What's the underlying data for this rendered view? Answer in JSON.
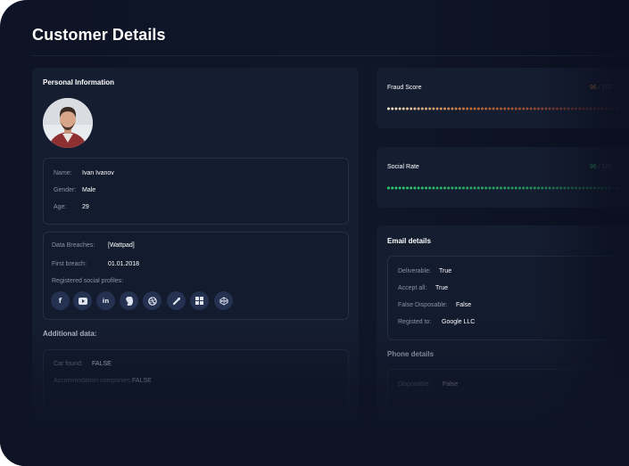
{
  "page_title": "Customer Details",
  "personal": {
    "heading": "Personal Information",
    "name_label": "Name:",
    "name": "Ivan Ivanov",
    "gender_label": "Gender:",
    "gender": "Male",
    "age_label": "Age:",
    "age": "29"
  },
  "breaches": {
    "data_breaches_label": "Data Breaches:",
    "data_breaches": "[Wattpad]",
    "first_breach_label": "First breach:",
    "first_breach": "01.01.2018",
    "social_label": "Registered social profiles:",
    "social_icons": [
      "facebook-icon",
      "youtube-icon",
      "linkedin-icon",
      "evernote-icon",
      "dribbble-icon",
      "gravatar-icon",
      "windows-icon",
      "codepen-icon"
    ]
  },
  "additional": {
    "heading": "Additional data:",
    "car_found_label": "Car found:",
    "car_found": "FALSE",
    "accommodation_label": "Accommodation companies:",
    "accommodation": "FALSE"
  },
  "fraud": {
    "label": "Fraud Score",
    "value": "96",
    "max": "/ 100",
    "fill": 0.96,
    "color_start": "#f5e6c8",
    "color_mid": "#e7823a",
    "color_end": "#c0392b"
  },
  "social_rate": {
    "label": "Social Rate",
    "value": "96",
    "max": "/ 100",
    "fill": 0.96,
    "color": "#2ecc71"
  },
  "email": {
    "heading": "Email details",
    "deliverable_label": "Deliverable:",
    "deliverable": "True",
    "accept_all_label": "Accept all:",
    "accept_all": "True",
    "disposable_label": "False Disposable:",
    "disposable": "False",
    "registered_label": "Registed to:",
    "registered": "Google LLC"
  },
  "phone": {
    "heading": "Phone details",
    "disposable_label": "Disposable:",
    "disposable": "False"
  }
}
